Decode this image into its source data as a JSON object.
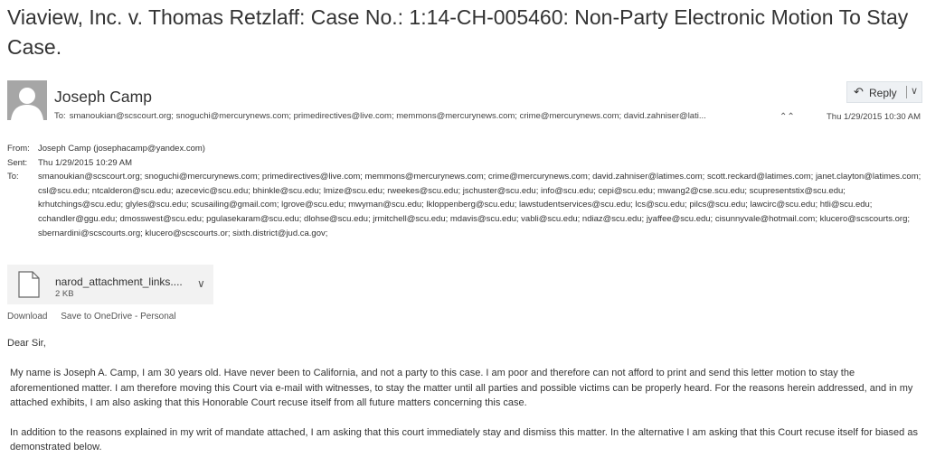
{
  "email": {
    "subject": "Viaview, Inc. v. Thomas Retzlaff: Case No.: 1:14-CH-005460: Non-Party Electronic Motion To Stay Case.",
    "sender_name": "Joseph Camp",
    "to_label": "To:",
    "to_summary": "smanoukian@scscourt.org; snoguchi@mercurynews.com; primedirectives@live.com; memmons@mercurynews.com; crime@mercurynews.com; david.zahniser@lati...",
    "date_header": "Thu 1/29/2015 10:30 AM",
    "reply_label": "Reply",
    "from_label": "From:",
    "from_value": "Joseph Camp (josephacamp@yandex.com)",
    "sent_label": "Sent:",
    "sent_value": "Thu 1/29/2015 10:29 AM",
    "to_full_label": "To:",
    "to_full": "smanoukian@scscourt.org; snoguchi@mercurynews.com; primedirectives@live.com; memmons@mercurynews.com; crime@mercurynews.com; david.zahniser@latimes.com; scott.reckard@latimes.com; janet.clayton@latimes.com; csl@scu.edu; ntcalderon@scu.edu; azecevic@scu.edu; bhinkle@scu.edu; lmize@scu.edu; rweekes@scu.edu; jschuster@scu.edu; info@scu.edu; cepi@scu.edu; mwang2@cse.scu.edu; scupresentstix@scu.edu; krhutchings@scu.edu; glyles@scu.edu; scusailing@gmail.com; lgrove@scu.edu; mwyman@scu.edu; lkloppenberg@scu.edu; lawstudentservices@scu.edu; lcs@scu.edu; pilcs@scu.edu; lawcirc@scu.edu; htli@scu.edu; cchandler@ggu.edu; dmosswest@scu.edu; pgulasekaram@scu.edu; dlohse@scu.edu; jrmitchell@scu.edu; mdavis@scu.edu; vabli@scu.edu; ndiaz@scu.edu; jyaffee@scu.edu; cisunnyvale@hotmail.com; klucero@scscourts.org; sbernardini@scscourts.org; klucero@scscourts.or; sixth.district@jud.ca.gov;"
  },
  "attachment": {
    "name": "narod_attachment_links....",
    "size": "2 KB",
    "download_label": "Download",
    "onedrive_label": "Save to OneDrive - Personal"
  },
  "body": {
    "greeting": "Dear Sir,",
    "paragraph1": "My name is Joseph A. Camp, I am 30 years old. Have never been to California, and not a party to this case. I am poor and therefore can not afford to print and send this letter motion to stay the aforementioned matter. I am therefore moving this Court via e-mail with witnesses, to stay the matter until all parties and possible victims can be properly heard. For the reasons herein addressed, and in my attached exhibits, I am also asking that this Honorable Court recuse itself from all future matters concerning this case.",
    "paragraph2": "In addition to the reasons explained in my writ of mandate attached, I am asking that this court immediately stay and dismiss this matter. In the alternative I am asking that this Court recuse itself for biased as demonstrated below."
  },
  "icons": {
    "avatar": "person-placeholder-icon",
    "reply": "reply-arrow-icon",
    "dropdown": "chevron-down-icon",
    "expand": "chevron-up-double-icon",
    "file": "document-icon"
  },
  "colors": {
    "avatar_bg": "#a6a6a6",
    "reply_bg": "#eef1f4",
    "attachment_bg": "#f2f2f2"
  }
}
